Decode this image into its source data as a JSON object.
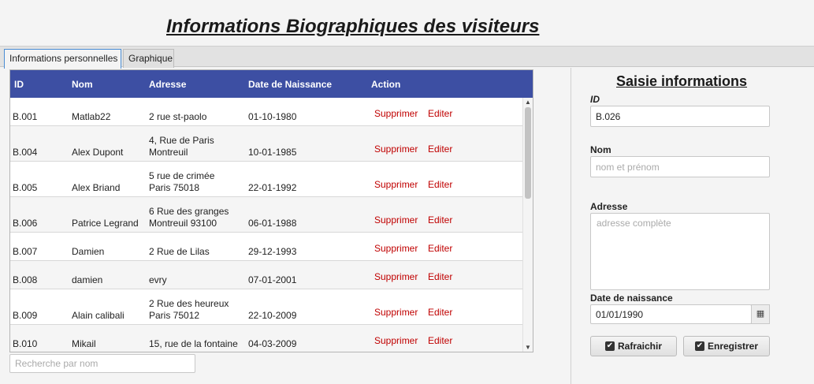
{
  "page": {
    "title": "Informations Biographiques des visiteurs"
  },
  "tabs": [
    {
      "label": "Informations personnelles",
      "active": true
    },
    {
      "label": "Graphique",
      "active": false
    }
  ],
  "table": {
    "columns": [
      "ID",
      "Nom",
      "Adresse",
      "Date de Naissance",
      "Action"
    ],
    "action_labels": {
      "delete": "Supprimer",
      "edit": "Editer"
    },
    "rows": [
      {
        "id": "B.001",
        "nom": "Matlab22",
        "adresse": "2 rue st-paolo",
        "date": "01-10-1980"
      },
      {
        "id": "B.004",
        "nom": "Alex Dupont",
        "adresse": "4, Rue de Paris\nMontreuil",
        "date": "10-01-1985"
      },
      {
        "id": "B.005",
        "nom": "Alex Briand",
        "adresse": "5 rue de crimée\nParis 75018",
        "date": "22-01-1992"
      },
      {
        "id": "B.006",
        "nom": "Patrice Legrand",
        "adresse": "6 Rue des granges\nMontreuil 93100",
        "date": "06-01-1988"
      },
      {
        "id": "B.007",
        "nom": "Damien",
        "adresse": "2 Rue de Lilas",
        "date": "29-12-1993"
      },
      {
        "id": "B.008",
        "nom": "damien",
        "adresse": "evry",
        "date": "07-01-2001"
      },
      {
        "id": "B.009",
        "nom": "Alain calibali",
        "adresse": "2 Rue des heureux\nParis 75012",
        "date": "22-10-2009"
      },
      {
        "id": "B.010",
        "nom": "Mikail",
        "adresse": "15, rue de la fontaine",
        "date": "04-03-2009"
      }
    ]
  },
  "search": {
    "placeholder": "Recherche par nom",
    "value": ""
  },
  "form": {
    "title": "Saisie informations",
    "id_label": "ID",
    "id_value": "B.026",
    "nom_label": "Nom",
    "nom_placeholder": "nom et prénom",
    "adresse_label": "Adresse",
    "adresse_placeholder": "adresse complète",
    "date_label": "Date de naissance",
    "date_value": "01/01/1990",
    "refresh_label": "Rafraichir",
    "save_label": "Enregistrer"
  },
  "icons": {
    "calendar": "calendar-icon",
    "checkbox": "checkbox-checked-icon",
    "scroll_up": "chevron-up-icon",
    "scroll_down": "chevron-down-icon"
  },
  "colors": {
    "table_header": "#3d4fa3",
    "action_link": "#c00000",
    "tab_active_border": "#4a8dd4"
  }
}
